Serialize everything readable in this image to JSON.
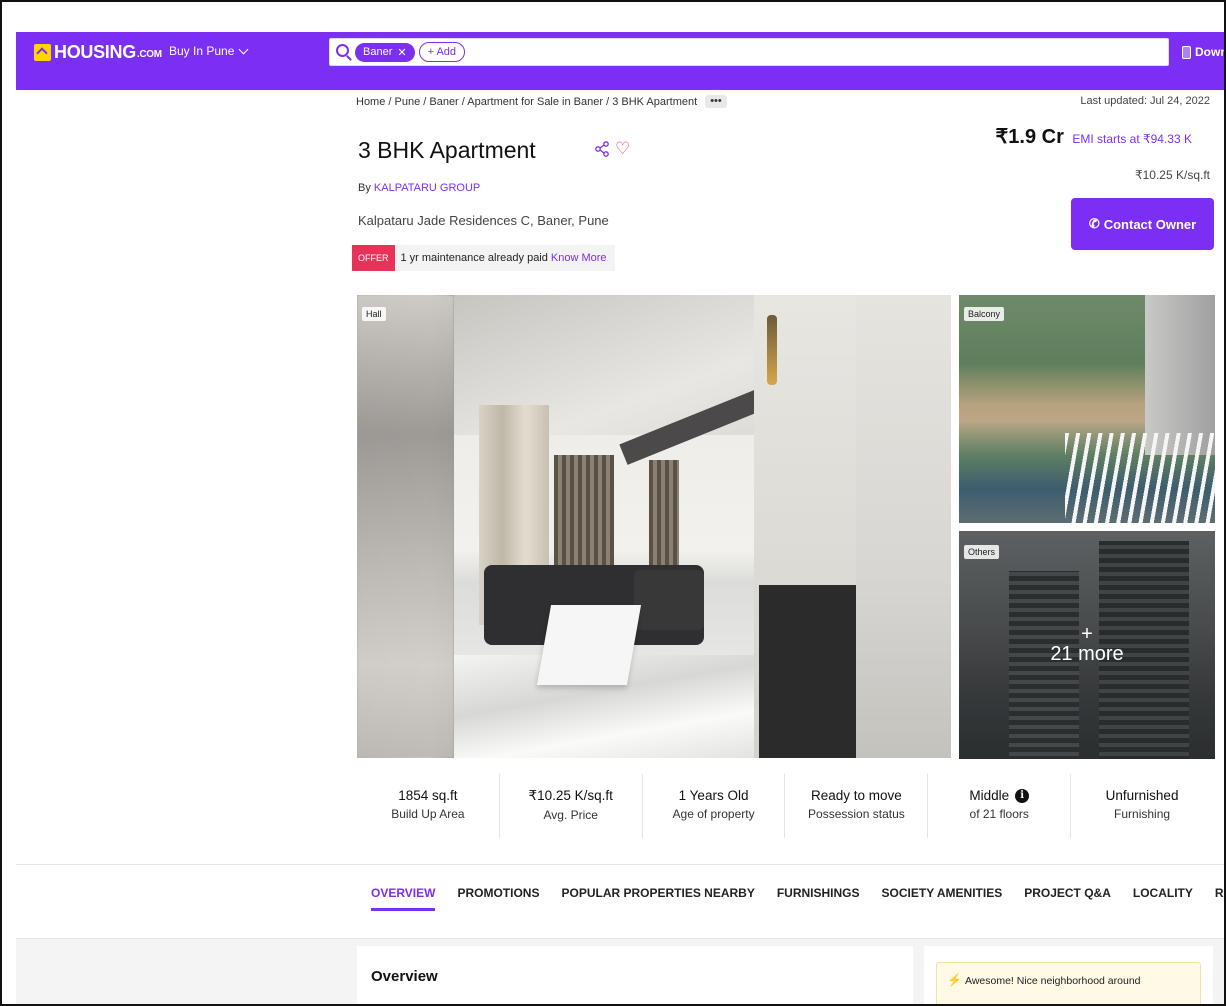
{
  "header": {
    "logo_text": "HOUSING",
    "logo_suffix": ".COM",
    "city_selector": "Buy In Pune",
    "search_chips": [
      "Baner"
    ],
    "add_chip_label": "+ Add",
    "download_label": "Downlo"
  },
  "breadcrumb": "Home / Pune / Baner / Apartment for Sale in Baner / 3 BHK Apartment",
  "breadcrumb_more": "•••",
  "last_updated": "Last updated: Jul 24, 2022",
  "listing": {
    "title": "3 BHK Apartment",
    "by_prefix": "By",
    "developer": "KALPATARU GROUP",
    "address": "Kalpataru Jade Residences C, Baner, Pune",
    "offer_badge": "OFFER",
    "offer_text": "1 yr maintenance already paid",
    "offer_link": "Know More",
    "price": "₹1.9 Cr",
    "emi": "EMI starts at ₹94.33 K",
    "price_per_sqft": "₹10.25 K/sq.ft",
    "contact_button": "Contact Owner"
  },
  "gallery": {
    "main_tag": "Hall",
    "side1_tag": "Balcony",
    "side2_tag": "Others",
    "more_plus": "+",
    "more_count": "21 more"
  },
  "stats": [
    {
      "value": "1854 sq.ft",
      "label": "Build Up Area"
    },
    {
      "value": "₹10.25 K/sq.ft",
      "label": "Avg. Price"
    },
    {
      "value": "1 Years Old",
      "label": "Age of property"
    },
    {
      "value": "Ready to move",
      "label": "Possession status"
    },
    {
      "value": "Middle",
      "label": "of 21 floors"
    },
    {
      "value": "Unfurnished",
      "label": "Furnishing"
    }
  ],
  "tabs": [
    "OVERVIEW",
    "PROMOTIONS",
    "POPULAR PROPERTIES NEARBY",
    "FURNISHINGS",
    "SOCIETY AMENITIES",
    "PROJECT Q&A",
    "LOCALITY",
    "RATINGS AI"
  ],
  "overview": {
    "heading": "Overview",
    "highlight": "Awesome! Nice neighborhood around"
  },
  "colors": {
    "brand": "#7b2ff2",
    "offer": "#e8325a",
    "logo_mark": "#ffd400"
  }
}
